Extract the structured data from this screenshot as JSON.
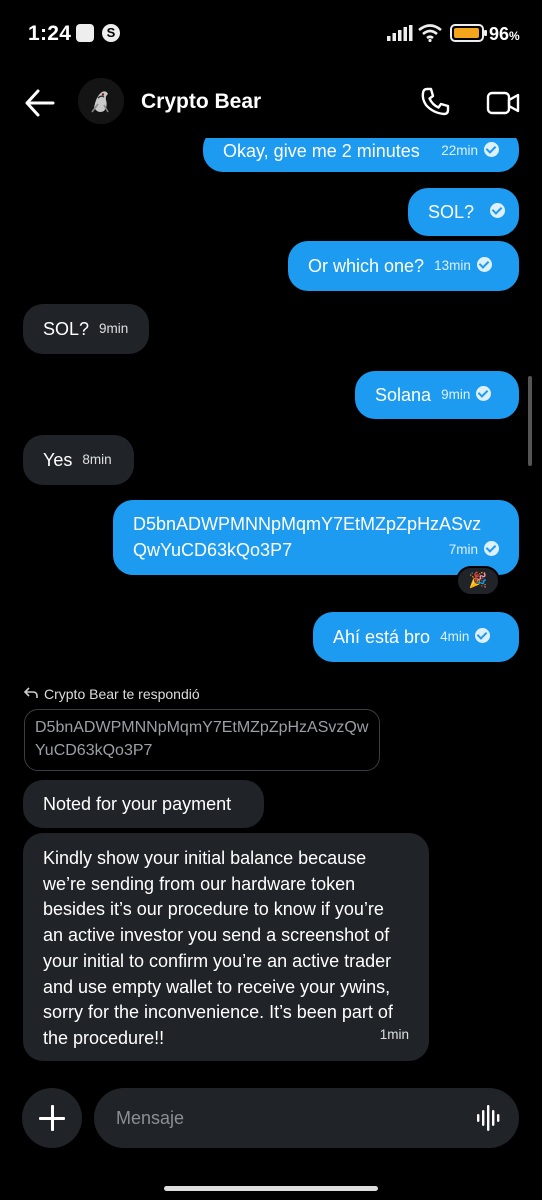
{
  "status_bar": {
    "time": "1:24",
    "battery_percent": "96",
    "battery_percent_symbol": "%",
    "battery_level": 0.96,
    "app_icon_letter": "S"
  },
  "header": {
    "contact_name": "Crypto Bear",
    "icons": [
      "back-arrow-icon",
      "phone-icon",
      "video-camera-icon"
    ]
  },
  "messages": [
    {
      "direction": "out",
      "text": "Okay, give me 2 minutes",
      "time": "22min",
      "read": true
    },
    {
      "direction": "out",
      "text": "SOL?",
      "time": "",
      "read": true
    },
    {
      "direction": "out",
      "text": "Or which one?",
      "time": "13min",
      "read": true
    },
    {
      "direction": "in",
      "text": "SOL?",
      "time": "9min"
    },
    {
      "direction": "out",
      "text": "Solana",
      "time": "9min",
      "read": true
    },
    {
      "direction": "in",
      "text": "Yes",
      "time": "8min"
    },
    {
      "direction": "out",
      "text_line1": "D5bnADWPMNNpMqmY7EtMZpZpHzASvz",
      "text_line2": "QwYuCD63kQo3P7",
      "time": "7min",
      "read": true,
      "reaction": "🎉"
    },
    {
      "direction": "out",
      "text": "Ahí está bro",
      "time": "4min",
      "read": true
    },
    {
      "direction": "in",
      "text": "Noted for your payment",
      "time": ""
    },
    {
      "direction": "in",
      "text": "Kindly show your initial balance because we’re sending from our hardware token besides it’s our procedure to know if you’re an active investor you send a screenshot of your initial to confirm you’re an active trader and use empty wallet to receive your ywins, sorry for the inconvenience. It’s been part of the procedure!!",
      "time": "1min"
    }
  ],
  "reply_context": {
    "label": "Crypto Bear te respondió",
    "quoted_text": "D5bnADWPMNNpMqmY7EtMZpZpHzASvzQwYuCD63kQo3P7"
  },
  "composer": {
    "placeholder": "Mensaje"
  },
  "colors": {
    "outgoing_bubble": "#1d9bf0",
    "incoming_bubble": "#202327",
    "background": "#000000",
    "battery": "#f5a51c"
  }
}
